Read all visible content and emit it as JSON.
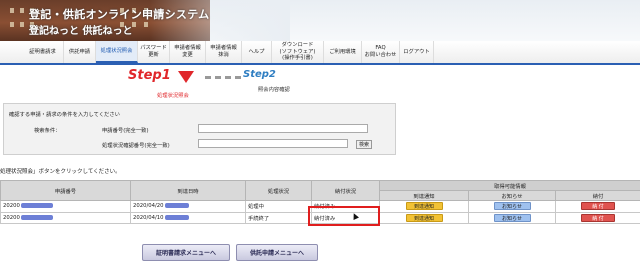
{
  "banner": {
    "title": "登記・供託オンライン申請システム",
    "subtitle": "登記ねっと 供託ねっと"
  },
  "nav": [
    {
      "label": "証明書請求"
    },
    {
      "label": "供託申請"
    },
    {
      "label": "処理状況照会",
      "active": true
    },
    {
      "label": "パスワード\n更新"
    },
    {
      "label": "申請者情報\n変更"
    },
    {
      "label": "申請者情報\n抹消"
    },
    {
      "label": "ヘルプ"
    },
    {
      "label": "ダウンロード\n(ソフトウェア)\n(操作手引書)"
    },
    {
      "label": "ご利用環境"
    },
    {
      "label": "FAQ\nお問い合わせ"
    },
    {
      "label": "ログアウト"
    }
  ],
  "steps": {
    "step1": "Step1",
    "step1_sub": "処理状況照会",
    "step2": "Step2",
    "step2_sub": "照会内容確認"
  },
  "search": {
    "hint": "確認する申請・請求の条件を入力してください",
    "condition_label": "検索条件：",
    "apply_number_label": "申請番号(完全一致)",
    "confirm_number_label": "処理状況確認番号(完全一致)",
    "search_button": "検索"
  },
  "instruction": "処理状況照会」ボタンをクリックしてください。",
  "table": {
    "headers": {
      "number": "申請番号",
      "arrival": "到達日時",
      "status": "処理状況",
      "payment": "納付状況",
      "group": "取得可能情報",
      "notice": "到達通知",
      "info": "お知らせ",
      "pay": "納付"
    },
    "rows": [
      {
        "number_prefix": "20200",
        "arrival": "2020/04/20",
        "status": "処理中",
        "payment": "納付済み",
        "notice_btn": "到達通知",
        "info_btn": "お知らせ",
        "pay_btn": "納 付"
      },
      {
        "number_prefix": "20200",
        "arrival": "2020/04/10",
        "status": "手続終了",
        "payment": "納付済み",
        "notice_btn": "到達通知",
        "info_btn": "お知らせ",
        "pay_btn": "納 付"
      }
    ]
  },
  "bottom_buttons": {
    "cert_menu": "証明書請求メニューへ",
    "deposit_menu": "供託申請メニューへ"
  },
  "colors": {
    "accent_blue": "#2b5fb3",
    "step_red": "#e0272b",
    "step_blue": "#2f7ec2",
    "highlight_red": "#e01e1e"
  }
}
